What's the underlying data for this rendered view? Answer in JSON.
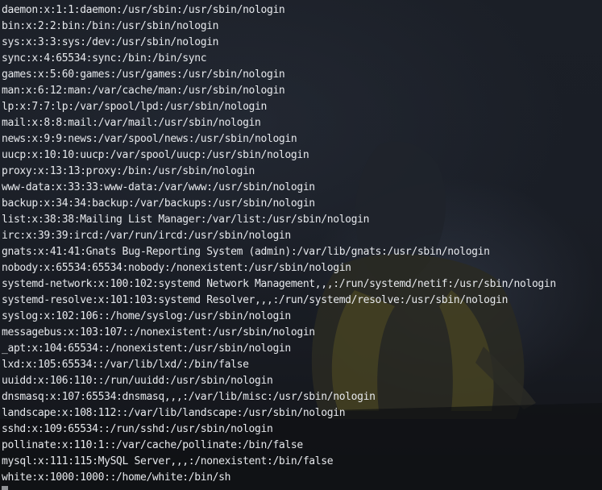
{
  "terminal": {
    "lines": [
      "daemon:x:1:1:daemon:/usr/sbin:/usr/sbin/nologin",
      "bin:x:2:2:bin:/bin:/usr/sbin/nologin",
      "sys:x:3:3:sys:/dev:/usr/sbin/nologin",
      "sync:x:4:65534:sync:/bin:/bin/sync",
      "games:x:5:60:games:/usr/games:/usr/sbin/nologin",
      "man:x:6:12:man:/var/cache/man:/usr/sbin/nologin",
      "lp:x:7:7:lp:/var/spool/lpd:/usr/sbin/nologin",
      "mail:x:8:8:mail:/var/mail:/usr/sbin/nologin",
      "news:x:9:9:news:/var/spool/news:/usr/sbin/nologin",
      "uucp:x:10:10:uucp:/var/spool/uucp:/usr/sbin/nologin",
      "proxy:x:13:13:proxy:/bin:/usr/sbin/nologin",
      "www-data:x:33:33:www-data:/var/www:/usr/sbin/nologin",
      "backup:x:34:34:backup:/var/backups:/usr/sbin/nologin",
      "list:x:38:38:Mailing List Manager:/var/list:/usr/sbin/nologin",
      "irc:x:39:39:ircd:/var/run/ircd:/usr/sbin/nologin",
      "gnats:x:41:41:Gnats Bug-Reporting System (admin):/var/lib/gnats:/usr/sbin/nologin",
      "nobody:x:65534:65534:nobody:/nonexistent:/usr/sbin/nologin",
      "systemd-network:x:100:102:systemd Network Management,,,:/run/systemd/netif:/usr/sbin/nologin",
      "systemd-resolve:x:101:103:systemd Resolver,,,:/run/systemd/resolve:/usr/sbin/nologin",
      "syslog:x:102:106::/home/syslog:/usr/sbin/nologin",
      "messagebus:x:103:107::/nonexistent:/usr/sbin/nologin",
      "_apt:x:104:65534::/nonexistent:/usr/sbin/nologin",
      "lxd:x:105:65534::/var/lib/lxd/:/bin/false",
      "uuidd:x:106:110::/run/uuidd:/usr/sbin/nologin",
      "dnsmasq:x:107:65534:dnsmasq,,,:/var/lib/misc:/usr/sbin/nologin",
      "landscape:x:108:112::/var/lib/landscape:/usr/sbin/nologin",
      "sshd:x:109:65534::/run/sshd:/usr/sbin/nologin",
      "pollinate:x:110:1::/var/cache/pollinate:/bin/false",
      "mysql:x:111:115:MySQL Server,,,:/nonexistent:/bin/false",
      "white:x:1000:1000::/home/white:/bin/sh"
    ]
  },
  "colors": {
    "background": "#1a1e26",
    "text": "#e6e8ec",
    "wallpaper_accent": "#8a8a3a"
  }
}
